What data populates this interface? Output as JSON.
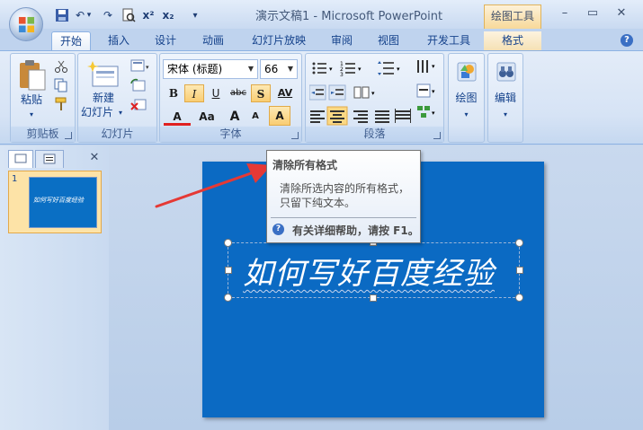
{
  "window": {
    "title": "演示文稿1 - Microsoft PowerPoint",
    "contextual_tab": "绘图工具",
    "controls": {
      "minimize": "–",
      "maximize": "▭",
      "close": "✕"
    }
  },
  "quick_access": {
    "save": "💾",
    "undo": "↶",
    "undo_arrow": "▾",
    "redo": "↷",
    "preview": "🔍",
    "superscript": "x²",
    "subscript": "x₂",
    "customize": "▾"
  },
  "tabs": [
    "开始",
    "插入",
    "设计",
    "动画",
    "幻灯片放映",
    "审阅",
    "视图",
    "开发工具",
    "格式"
  ],
  "ribbon": {
    "clipboard": {
      "label": "剪贴板",
      "paste": "粘贴",
      "paste_arrow": "▾"
    },
    "slides": {
      "label": "幻灯片",
      "new_slide_line1": "新建",
      "new_slide_line2": "幻灯片",
      "new_slide_arrow": "▾"
    },
    "font": {
      "label": "字体",
      "font_name": "宋体 (标题)",
      "font_size": "66",
      "bold": "B",
      "italic": "I",
      "underline": "U",
      "strikethrough": "abc",
      "shadow": "S",
      "char_spacing": "AV",
      "font_color": "A",
      "change_case": "Aa",
      "grow": "A",
      "shrink": "A",
      "clear_format": "A"
    },
    "paragraph": {
      "label": "段落"
    },
    "drawing": {
      "label": "绘图",
      "arrow": "▾"
    },
    "editing": {
      "label": "编辑",
      "arrow": "▾"
    }
  },
  "thumbnail_pane": {
    "close": "✕",
    "slide_number": "1",
    "slide_text": "如何写好百度经验"
  },
  "slide": {
    "title": "如何写好百度经验"
  },
  "tooltip": {
    "title": "清除所有格式",
    "line1": "清除所选内容的所有格式，",
    "line2": "只留下纯文本。",
    "help_icon": "?",
    "help": "有关详细帮助，请按 F1。"
  },
  "colors": {
    "accent": "#0b6ac3",
    "arrow": "#e53935",
    "ribbon": "#d6e3f5"
  }
}
